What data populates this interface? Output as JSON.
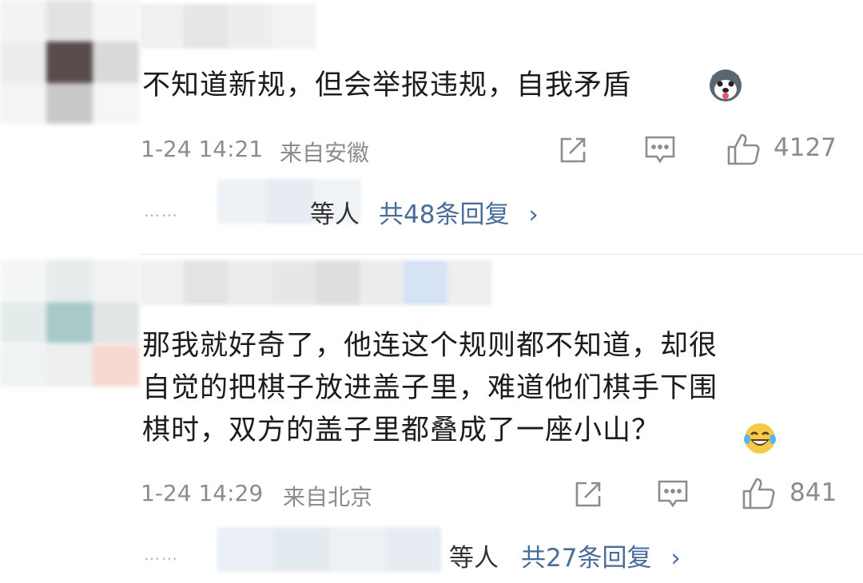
{
  "comments": [
    {
      "text_lines": [
        "不知道新规，但会举报违规，自我矛盾"
      ],
      "date": "1-24 14:21",
      "location": "来自安徽",
      "likes": "4127",
      "replies": {
        "prefix": "……",
        "others": "等人",
        "count_label": "共48条回复",
        "arrow": "›"
      },
      "emoji": "husky-emoji"
    },
    {
      "text_lines": [
        "那我就好奇了，他连这个规则都不知道，却很",
        "自觉的把棋子放进盖子里，难道他们棋手下围",
        "棋时，双方的盖子里都叠成了一座小山？"
      ],
      "date": "1-24 14:29",
      "location": "来自北京",
      "likes": "841",
      "replies": {
        "prefix": "……",
        "others": "等人",
        "count_label": "共27条回复",
        "arrow": "›"
      },
      "emoji": "laughing-tears-emoji"
    }
  ],
  "colors": {
    "link": "#4a6c9c",
    "meta": "#8c8c8c",
    "text": "#1c1c1c"
  },
  "icons": [
    "share-icon",
    "comment-icon",
    "like-icon"
  ]
}
